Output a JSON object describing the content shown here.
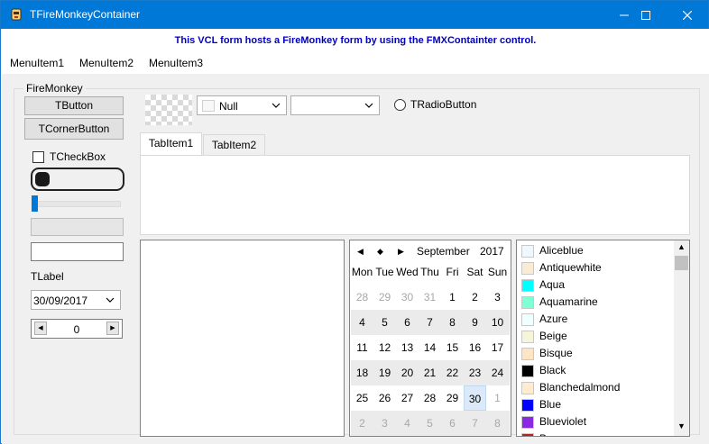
{
  "window": {
    "title": "TFireMonkeyContainer",
    "controls": {
      "minimize": "─",
      "maximize": "☐",
      "close": "✕"
    }
  },
  "banner": {
    "text": "This VCL form hosts a FireMonkey form by using the FMXContainter control."
  },
  "menu": {
    "items": [
      "MenuItem1",
      "MenuItem2",
      "MenuItem3"
    ]
  },
  "group": {
    "caption": "FireMonkey"
  },
  "left": {
    "button_label": "TButton",
    "corner_button_label": "TCornerButton",
    "checkbox_label": "TCheckBox",
    "label_text": "TLabel",
    "date_value": "30/09/2017",
    "spin_value": "0",
    "spin_left": "◀",
    "spin_right": "▶"
  },
  "toolbar": {
    "color_combo_value": "Null",
    "combo_arrow": "⌄",
    "empty_combo_value": "",
    "radio_label": "TRadioButton"
  },
  "tabs": [
    {
      "label": "TabItem1",
      "active": true
    },
    {
      "label": "TabItem2",
      "active": false
    }
  ],
  "calendar": {
    "nav": {
      "prev": "◀",
      "today": "◆",
      "next": "▶"
    },
    "month": "September",
    "year": "2017",
    "weekdays": [
      "Mon",
      "Tue",
      "Wed",
      "Thu",
      "Fri",
      "Sat",
      "Sun"
    ],
    "weeks": [
      [
        {
          "d": "28",
          "g": true
        },
        {
          "d": "29",
          "g": true
        },
        {
          "d": "30",
          "g": true
        },
        {
          "d": "31",
          "g": true
        },
        {
          "d": "1"
        },
        {
          "d": "2"
        },
        {
          "d": "3"
        }
      ],
      [
        {
          "d": "4"
        },
        {
          "d": "5"
        },
        {
          "d": "6"
        },
        {
          "d": "7"
        },
        {
          "d": "8"
        },
        {
          "d": "9"
        },
        {
          "d": "10"
        }
      ],
      [
        {
          "d": "11"
        },
        {
          "d": "12"
        },
        {
          "d": "13"
        },
        {
          "d": "14"
        },
        {
          "d": "15"
        },
        {
          "d": "16"
        },
        {
          "d": "17"
        }
      ],
      [
        {
          "d": "18"
        },
        {
          "d": "19"
        },
        {
          "d": "20"
        },
        {
          "d": "21"
        },
        {
          "d": "22"
        },
        {
          "d": "23"
        },
        {
          "d": "24"
        }
      ],
      [
        {
          "d": "25"
        },
        {
          "d": "26"
        },
        {
          "d": "27"
        },
        {
          "d": "28"
        },
        {
          "d": "29"
        },
        {
          "d": "30",
          "sel": true
        },
        {
          "d": "1",
          "g": true
        }
      ],
      [
        {
          "d": "2",
          "g": true
        },
        {
          "d": "3",
          "g": true
        },
        {
          "d": "4",
          "g": true
        },
        {
          "d": "5",
          "g": true
        },
        {
          "d": "6",
          "g": true
        },
        {
          "d": "7",
          "g": true
        },
        {
          "d": "8",
          "g": true
        }
      ]
    ]
  },
  "colors": [
    {
      "name": "Aliceblue",
      "hex": "#f0f8ff"
    },
    {
      "name": "Antiquewhite",
      "hex": "#faebd7"
    },
    {
      "name": "Aqua",
      "hex": "#00ffff"
    },
    {
      "name": "Aquamarine",
      "hex": "#7fffd4"
    },
    {
      "name": "Azure",
      "hex": "#f0ffff"
    },
    {
      "name": "Beige",
      "hex": "#f5f5dc"
    },
    {
      "name": "Bisque",
      "hex": "#ffe4c4"
    },
    {
      "name": "Black",
      "hex": "#000000"
    },
    {
      "name": "Blanchedalmond",
      "hex": "#ffebcd"
    },
    {
      "name": "Blue",
      "hex": "#0000ff"
    },
    {
      "name": "Blueviolet",
      "hex": "#8a2be2"
    },
    {
      "name": "Brown",
      "hex": "#a52a2a"
    }
  ],
  "scroll": {
    "up": "▲",
    "down": "▼"
  },
  "theme": {
    "titlebar": "#0078d7",
    "banner_text": "#0000c0",
    "accent": "#0078d7"
  }
}
